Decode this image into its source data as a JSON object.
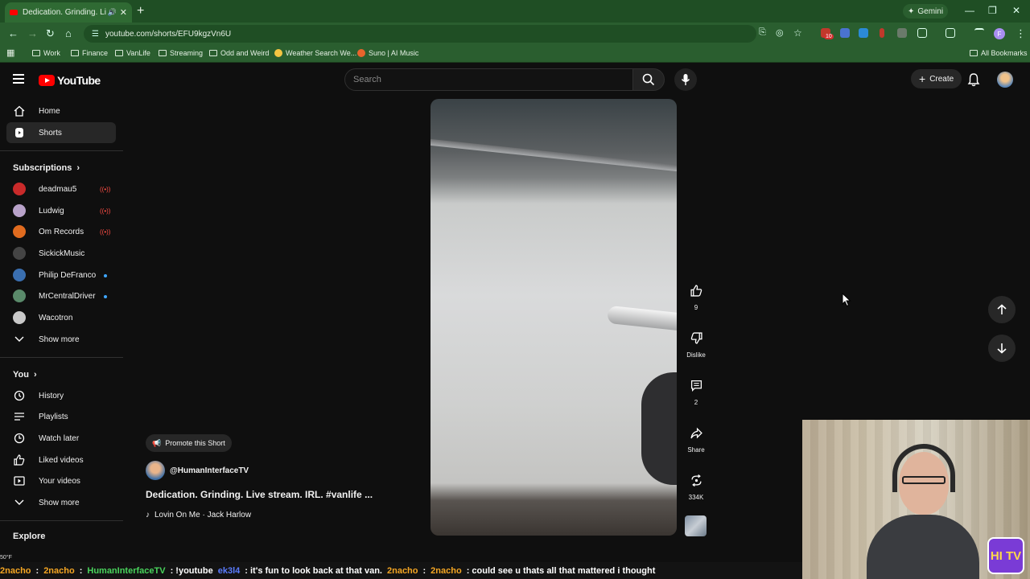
{
  "browser": {
    "tab_title": "Dedication. Grinding. Live s",
    "url": "youtube.com/shorts/EFU9kgzVn6U",
    "gemini_label": "Gemini",
    "bookmarks": [
      "Work",
      "Finance",
      "VanLife",
      "Streaming",
      "Odd and Weird",
      "Weather Search We...",
      "Suno | AI Music"
    ],
    "all_bookmarks": "All Bookmarks",
    "ext_badge": "10"
  },
  "youtube": {
    "logo_text": "YouTube",
    "search_placeholder": "Search",
    "create_label": "Create"
  },
  "sidebar": {
    "home": "Home",
    "shorts": "Shorts",
    "subscriptions_heading": "Subscriptions",
    "subscriptions": [
      {
        "name": "deadmau5",
        "color": "#c92a2a"
      },
      {
        "name": "Ludwig",
        "color": "#b8a2c9"
      },
      {
        "name": "Om Records",
        "color": "#e06b1f"
      },
      {
        "name": "SickickMusic",
        "color": "#444444"
      },
      {
        "name": "Philip DeFranco",
        "color": "#3a6fb0"
      },
      {
        "name": "MrCentralDriver",
        "color": "#5a8a6a"
      },
      {
        "name": "Wacotron",
        "color": "#c9c9c9"
      }
    ],
    "show_more": "Show more",
    "you_heading": "You",
    "you_items": [
      "History",
      "Playlists",
      "Watch later",
      "Liked videos",
      "Your videos"
    ],
    "show_more_2": "Show more",
    "explore_heading": "Explore"
  },
  "short": {
    "promote_label": "Promote this Short",
    "channel": "@HumanInterfaceTV",
    "title": "Dedication. Grinding. Live stream. IRL. #vanlife ...",
    "sound": "Lovin On Me · Jack Harlow"
  },
  "actions": {
    "likes": "9",
    "dislike": "Dislike",
    "comments": "2",
    "share": "Share",
    "remix": "334K"
  },
  "ticker": {
    "weather": "50°F",
    "items": [
      {
        "user": "2nacho",
        "msg": ":"
      },
      {
        "user": "2nacho",
        "msg": ":"
      },
      {
        "user": "HumanInterfaceTV",
        "msg": ": !youtube"
      },
      {
        "user": "ek3l4",
        "msg": ": it's fun to look back at that van."
      },
      {
        "user": "2nacho",
        "msg": ":"
      },
      {
        "user": "2nacho",
        "msg": ": could see u thats all that mattered i thought"
      }
    ]
  },
  "overlay": {
    "logo_text": "HI TV"
  }
}
